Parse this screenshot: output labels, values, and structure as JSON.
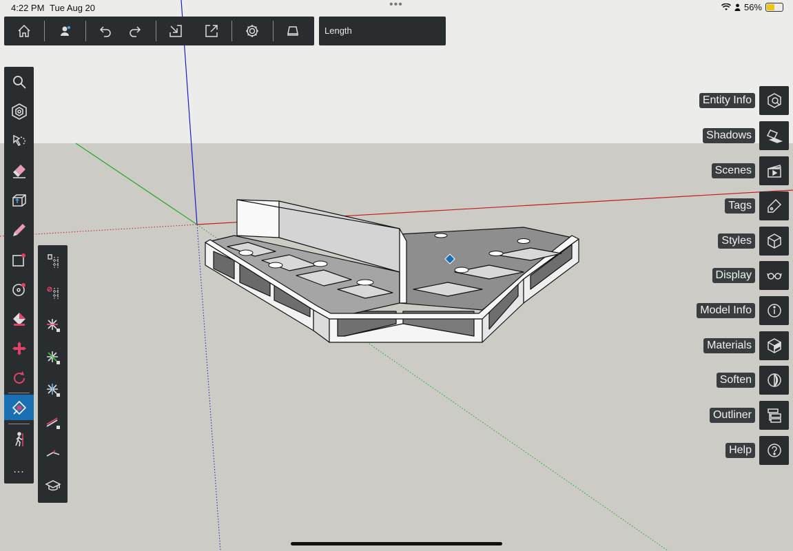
{
  "status_bar": {
    "time": "4:22 PM",
    "date": "Tue Aug 20",
    "battery_percent": "56%",
    "battery_level": 0.56
  },
  "top_toolbar": {
    "buttons": [
      "home-icon",
      "user-icon",
      "undo-icon",
      "redo-icon",
      "import-icon",
      "export-icon",
      "settings-icon",
      "display-toggle-icon"
    ]
  },
  "measurements": {
    "label": "Length"
  },
  "left_toolbar": {
    "tools": [
      "search-tool-icon",
      "select-tool-icon",
      "lasso-tool-icon",
      "eraser-tool-icon",
      "push-pull-tool-icon",
      "pencil-tool-icon",
      "rectangle-tool-icon",
      "circle-tool-icon",
      "paint-bucket-tool-icon",
      "move-tool-icon",
      "rotate-tool-icon",
      "tape-measure-tool-icon",
      "walk-tool-icon"
    ],
    "active_tool": "tape-measure-tool-icon",
    "more_label": "..."
  },
  "sub_toolbar": {
    "tools": [
      "delete-guides-icon",
      "hide-guides-icon",
      "lock-axis-red-icon",
      "lock-axis-green-icon",
      "lock-axis-blue-icon",
      "lock-axis-magenta-icon",
      "parallel-inference-icon",
      "tutorial-icon"
    ]
  },
  "right_panels": [
    {
      "label": "Entity Info",
      "icon": "entity-info-icon"
    },
    {
      "label": "Shadows",
      "icon": "shadows-icon"
    },
    {
      "label": "Scenes",
      "icon": "scenes-icon"
    },
    {
      "label": "Tags",
      "icon": "tags-icon"
    },
    {
      "label": "Styles",
      "icon": "styles-icon"
    },
    {
      "label": "Display",
      "icon": "display-icon"
    },
    {
      "label": "Model Info",
      "icon": "model-info-icon"
    },
    {
      "label": "Materials",
      "icon": "materials-icon"
    },
    {
      "label": "Soften",
      "icon": "soften-icon"
    },
    {
      "label": "Outliner",
      "icon": "outliner-icon"
    },
    {
      "label": "Help",
      "icon": "help-icon"
    }
  ],
  "colors": {
    "toolbar": "#2a2d30",
    "active": "#1a6fb3",
    "axis_red": "#c41c1c",
    "axis_green": "#22a822",
    "axis_blue": "#1a1acc",
    "sky": "#ececeb",
    "ground": "#cccbc6"
  }
}
